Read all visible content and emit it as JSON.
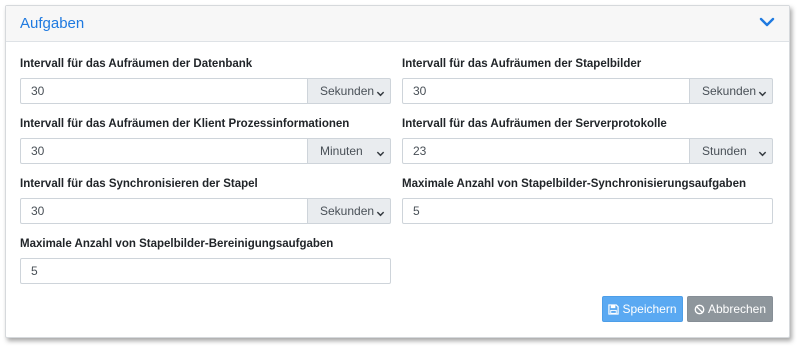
{
  "card": {
    "title": "Aufgaben",
    "collapse_icon": "chevron-down-icon"
  },
  "fields": {
    "datenbank": {
      "label": "Intervall für das Aufräumen der Datenbank",
      "value": "30",
      "unit": "Sekunden"
    },
    "stapelbilder": {
      "label": "Intervall für das Aufräumen der Stapelbilder",
      "value": "30",
      "unit": "Sekunden"
    },
    "klient": {
      "label": "Intervall für das Aufräumen der Klient Prozessinformationen",
      "value": "30",
      "unit": "Minuten"
    },
    "serverprotokolle": {
      "label": "Intervall für das Aufräumen der Serverprotokolle",
      "value": "23",
      "unit": "Stunden"
    },
    "synchronisieren": {
      "label": "Intervall für das Synchronisieren der Stapel",
      "value": "30",
      "unit": "Sekunden"
    },
    "max_sync": {
      "label": "Maximale Anzahl von Stapelbilder-Synchronisierungsaufgaben",
      "value": "5"
    },
    "max_bereinigung": {
      "label": "Maximale Anzahl von Stapelbilder-Bereinigungsaufgaben",
      "value": "5"
    }
  },
  "buttons": {
    "save_label": "Speichern",
    "save_icon": "floppy-disk-icon",
    "cancel_label": "Abbrechen",
    "cancel_icon": "ban-icon"
  },
  "colors": {
    "title": "#1f7ae0",
    "save": "#5aa9f2",
    "cancel": "#8e969c"
  }
}
